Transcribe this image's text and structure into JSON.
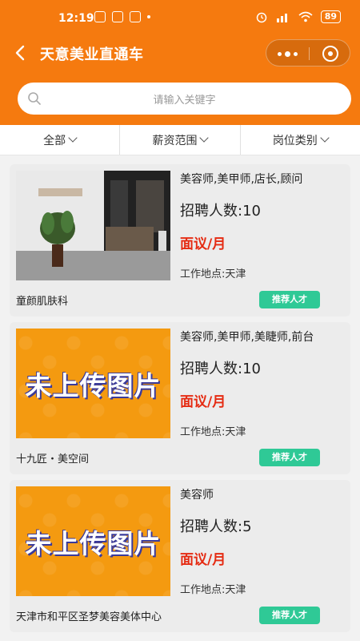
{
  "status_bar": {
    "time": "12:19",
    "battery": "89"
  },
  "nav": {
    "title": "天意美业直通车",
    "back_icon": "chevron-left-icon",
    "more_icon": "more-dots-icon",
    "close_icon": "target-icon"
  },
  "search": {
    "placeholder": "请输入关键字"
  },
  "filters": [
    {
      "label": "全部"
    },
    {
      "label": "薪资范围"
    },
    {
      "label": "岗位类别"
    }
  ],
  "colors": {
    "header": "#f57a0f",
    "salary": "#e52b12",
    "recommend": "#2fc996"
  },
  "jobs": [
    {
      "title": "美容师,美甲师,店长,顾问",
      "count": "招聘人数:10",
      "salary": "面议/月",
      "location": "工作地点:天津",
      "company": "童颜肌肤科",
      "button": "推荐人才",
      "image": "salon-photo"
    },
    {
      "title": "美容师,美甲师,美睫师,前台",
      "count": "招聘人数:10",
      "salary": "面议/月",
      "location": "工作地点:天津",
      "company": "十九匠・美空间",
      "button": "推荐人才",
      "image_text": "未上传图片"
    },
    {
      "title": "美容师",
      "count": "招聘人数:5",
      "salary": "面议/月",
      "location": "工作地点:天津",
      "company": "天津市和平区圣梦美容美体中心",
      "button": "推荐人才",
      "image_text": "未上传图片"
    }
  ]
}
